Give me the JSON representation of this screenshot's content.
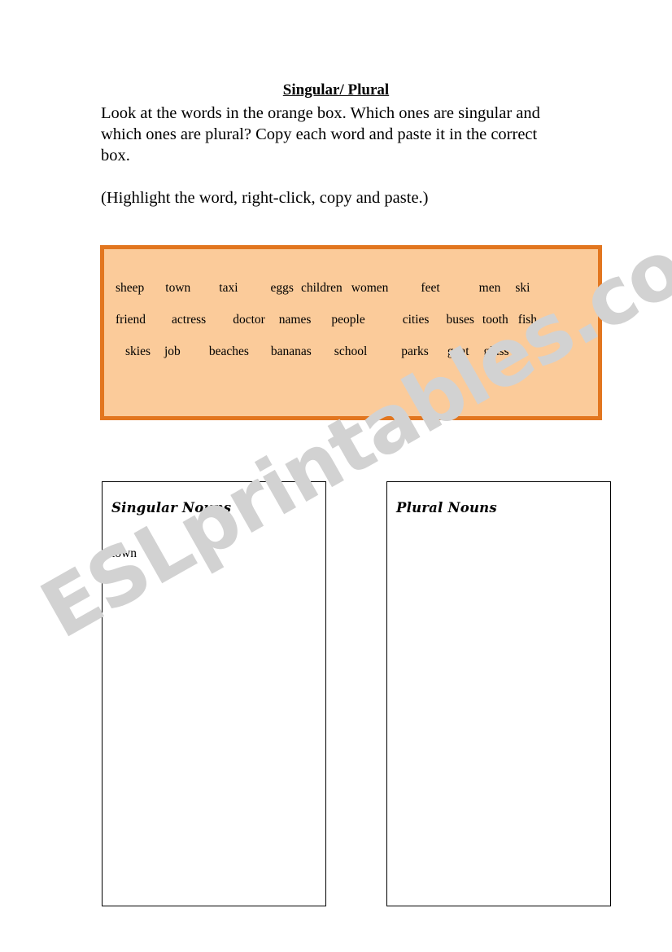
{
  "worksheet": {
    "title": "Singular/ Plural",
    "instructions": [
      "Look at the words in the orange box. Which ones are singular and which ones are plural? Copy each word and paste it in the correct box.",
      "(Highlight the word, right-click, copy and paste.)"
    ]
  },
  "word_bank": {
    "rows": [
      {
        "words": [
          {
            "text": "sheep",
            "gap": 0
          },
          {
            "text": "town",
            "gap": 26
          },
          {
            "text": "taxi",
            "gap": 35
          },
          {
            "text": "eggs",
            "gap": 40
          },
          {
            "text": "children",
            "gap": 9
          },
          {
            "text": "women",
            "gap": 11
          },
          {
            "text": "feet",
            "gap": 40
          },
          {
            "text": "men",
            "gap": 48
          },
          {
            "text": "ski",
            "gap": 18
          }
        ]
      },
      {
        "words": [
          {
            "text": "friend",
            "gap": 0
          },
          {
            "text": "actress",
            "gap": 32
          },
          {
            "text": "doctor",
            "gap": 33
          },
          {
            "text": "names",
            "gap": 17
          },
          {
            "text": "people",
            "gap": 25
          },
          {
            "text": "cities",
            "gap": 46
          },
          {
            "text": "buses",
            "gap": 21
          },
          {
            "text": "tooth",
            "gap": 10
          },
          {
            "text": "fish",
            "gap": 12
          }
        ]
      },
      {
        "words": [
          {
            "text": "skies",
            "gap": 12
          },
          {
            "text": "job",
            "gap": 17
          },
          {
            "text": "beaches",
            "gap": 35
          },
          {
            "text": "bananas",
            "gap": 27
          },
          {
            "text": "school",
            "gap": 28
          },
          {
            "text": "parks",
            "gap": 42
          },
          {
            "text": "goat",
            "gap": 23
          },
          {
            "text": "glass",
            "gap": 18
          }
        ]
      }
    ]
  },
  "answer_boxes": {
    "singular": {
      "title": "Singular Nouns",
      "entries": [
        "town"
      ]
    },
    "plural": {
      "title": "Plural Nouns",
      "entries": []
    }
  },
  "watermark": {
    "text": "ESLprintables.com",
    "color": "#d2d2d2"
  },
  "colors": {
    "bank_fill": "#fbcb9a",
    "bank_border": "#e2761f",
    "box_border": "#000000",
    "text": "#000000"
  }
}
